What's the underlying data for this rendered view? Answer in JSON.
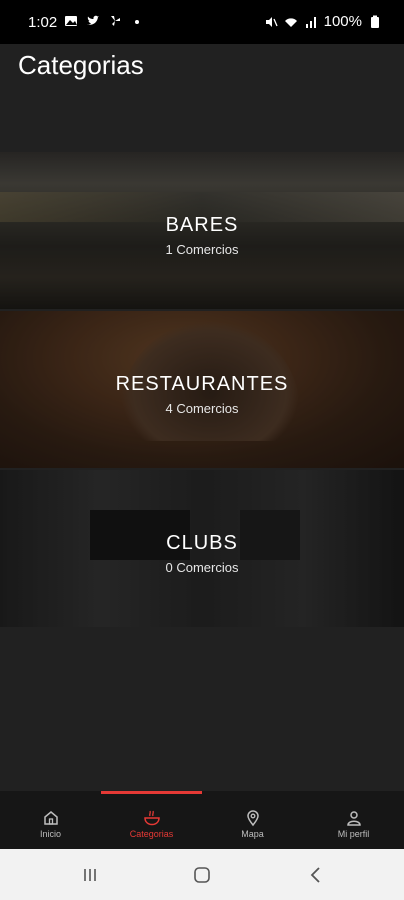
{
  "status_bar": {
    "time": "1:02",
    "battery": "100%",
    "icons": [
      "image-icon",
      "twitter-icon",
      "fan-icon",
      "dot-icon",
      "mute-icon",
      "wifi-icon",
      "signal-icon",
      "battery-icon"
    ]
  },
  "header": {
    "title": "Categorias"
  },
  "categories": [
    {
      "name": "BARES",
      "count": "1 Comercios"
    },
    {
      "name": "RESTAURANTES",
      "count": "4 Comercios"
    },
    {
      "name": "CLUBS",
      "count": "0 Comercios"
    }
  ],
  "bottom_nav": {
    "items": [
      {
        "label": "Inicio",
        "icon": "home-icon",
        "active": false
      },
      {
        "label": "Categorias",
        "icon": "bowl-icon",
        "active": true
      },
      {
        "label": "Mapa",
        "icon": "map-pin-icon",
        "active": false
      },
      {
        "label": "Mi perfil",
        "icon": "user-icon",
        "active": false
      }
    ],
    "accent_color": "#e53935"
  },
  "system_nav": {
    "icons": [
      "recents-icon",
      "home-button-icon",
      "back-icon"
    ]
  }
}
